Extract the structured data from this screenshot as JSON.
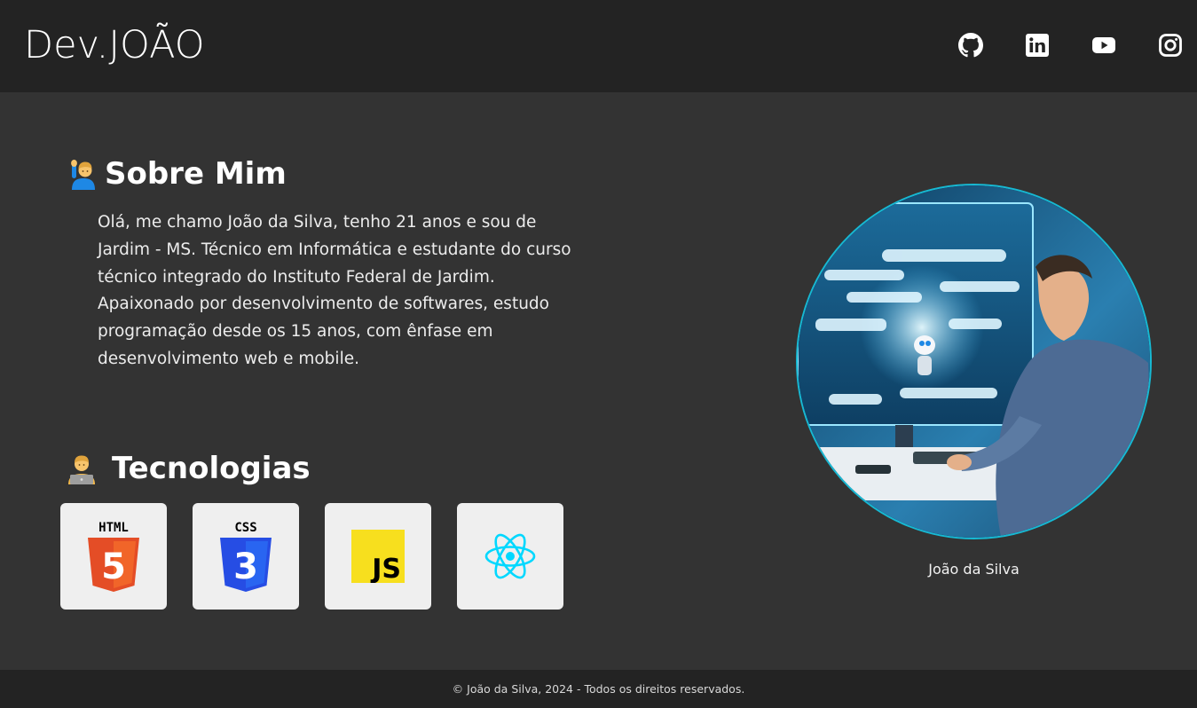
{
  "header": {
    "logo": "Dev.JOÃO",
    "social": [
      {
        "icon": "github-icon"
      },
      {
        "icon": "linkedin-icon"
      },
      {
        "icon": "youtube-icon"
      },
      {
        "icon": "instagram-icon"
      }
    ]
  },
  "about": {
    "title": "Sobre Mim",
    "title_icon": "person-raising-hand-emoji",
    "paragraph": "Olá, me chamo João da Silva, tenho 21 anos e sou de Jardim - MS. Técnico em Informática e estudante do curso técnico integrado do Instituto Federal de Jardim. Apaixonado por desenvolvimento de softwares, estudo programação desde os 15 anos, com ênfase em desenvolvimento web e mobile."
  },
  "technologies": {
    "title": "Tecnologias",
    "title_icon": "technologist-emoji",
    "items": [
      {
        "label": "HTML",
        "badge": "5",
        "icon": "html5-icon",
        "color": "#e44d26"
      },
      {
        "label": "CSS",
        "badge": "3",
        "icon": "css3-icon",
        "color": "#264de4"
      },
      {
        "label": "JS",
        "icon": "javascript-icon",
        "color": "#f7df1e"
      },
      {
        "icon": "react-icon",
        "color": "#00d8ff"
      }
    ]
  },
  "profile": {
    "caption": "João da Silva",
    "accent": "#17b9d3"
  },
  "footer": {
    "copyright": "© João da Silva, 2024 - Todos os direitos reservados."
  },
  "colors": {
    "background": "#333333",
    "header": "#232323",
    "card": "#efefef"
  }
}
